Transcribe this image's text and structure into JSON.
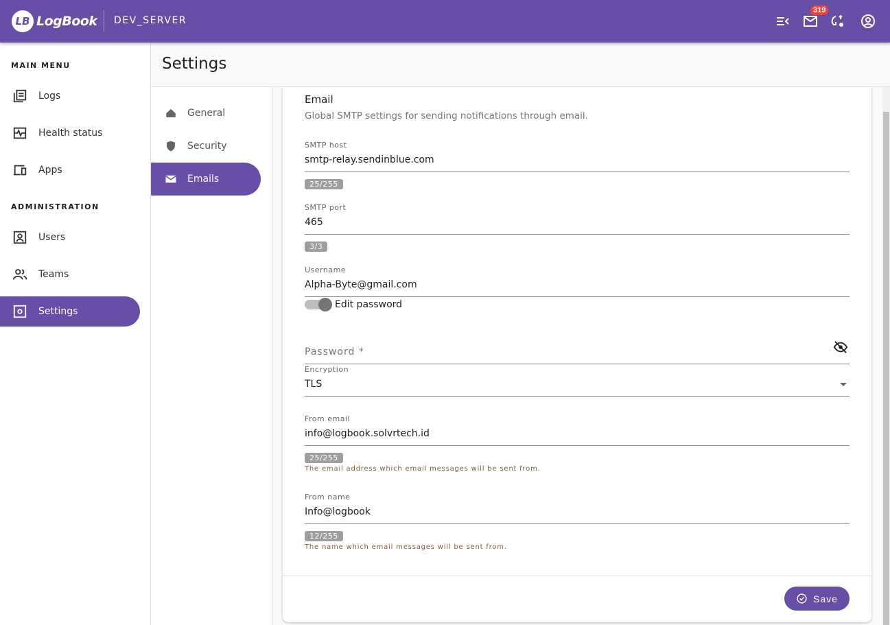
{
  "header": {
    "logo_text": "LogBook",
    "logo_mark": "LB",
    "server": "DEV_SERVER",
    "notification_count": "319",
    "icons": [
      "menu-collapse-icon",
      "mail-icon",
      "sync-settings-icon",
      "account-circle-icon"
    ]
  },
  "sidebar": {
    "main_menu": "MAIN MENU",
    "administration": "ADMINISTRATION",
    "items": [
      {
        "label": "Logs",
        "icon": "logs-icon"
      },
      {
        "label": "Health status",
        "icon": "health-icon"
      },
      {
        "label": "Apps",
        "icon": "devices-icon"
      },
      {
        "label": "Users",
        "icon": "user-icon"
      },
      {
        "label": "Teams",
        "icon": "teams-icon"
      },
      {
        "label": "Settings",
        "icon": "settings-icon",
        "active": true
      }
    ]
  },
  "page": {
    "title": "Settings"
  },
  "subnav": {
    "items": [
      {
        "label": "General"
      },
      {
        "label": "Security"
      },
      {
        "label": "Emails",
        "active": true
      }
    ]
  },
  "email": {
    "title": "Email",
    "description": "Global SMTP settings for sending notifications through email.",
    "smtp_host": {
      "label": "SMTP host",
      "value": "smtp-relay.sendinblue.com",
      "counter": "25/255"
    },
    "smtp_port": {
      "label": "SMTP port",
      "value": "465",
      "counter": "3/3"
    },
    "username": {
      "label": "Username",
      "value": "Alpha-Byte@gmail.com"
    },
    "edit_password": {
      "label": "Edit password",
      "on": true
    },
    "password": {
      "placeholder": "Password *"
    },
    "encryption": {
      "label": "Encryption",
      "value": "TLS"
    },
    "from_email": {
      "label": "From email",
      "value": "info@logbook.solvrtech.id",
      "counter": "25/255",
      "hint": "The email address which email messages will be sent from."
    },
    "from_name": {
      "label": "From name",
      "value": "Info@logbook",
      "counter": "12/255",
      "hint": "The name which email messages will be sent from."
    },
    "save_label": "Save"
  },
  "colors": {
    "primary": "#674ea7",
    "badge": "#f44336"
  }
}
